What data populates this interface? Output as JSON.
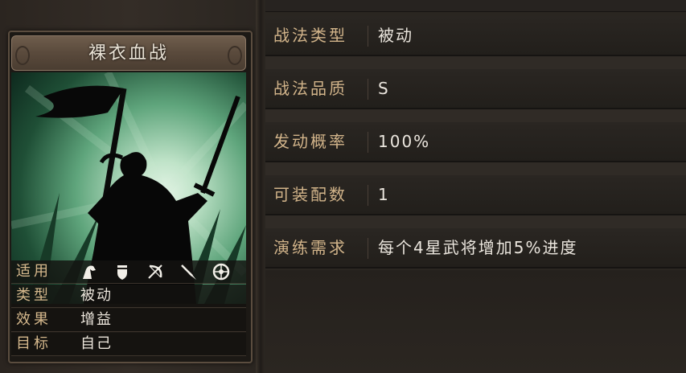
{
  "skill_card": {
    "name": "裸衣血战",
    "info": [
      {
        "label": "适用",
        "value": ""
      },
      {
        "label": "类型",
        "value": "被动"
      },
      {
        "label": "效果",
        "value": "增益"
      },
      {
        "label": "目标",
        "value": "自己"
      }
    ],
    "applicable_unit_icons": [
      "cavalry-icon",
      "shield-icon",
      "bow-icon",
      "spear-icon",
      "siege-icon"
    ]
  },
  "attributes": [
    {
      "label": "战法类型",
      "value": "被动"
    },
    {
      "label": "战法品质",
      "value": "S"
    },
    {
      "label": "发动概率",
      "value": "100%"
    },
    {
      "label": "可装配数",
      "value": "1"
    },
    {
      "label": "演练需求",
      "value": "每个4星武将增加5%进度"
    }
  ],
  "colors": {
    "label_gold": "#d2b48a",
    "value_white": "#ebe6de",
    "art_green": "#5fa57c"
  }
}
